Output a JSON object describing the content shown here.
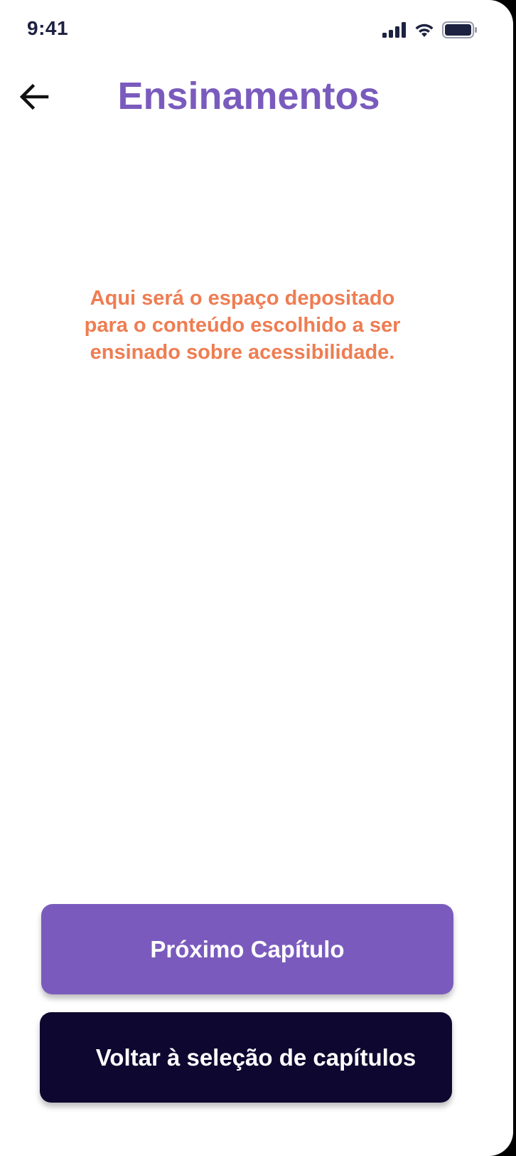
{
  "status_bar": {
    "time": "9:41",
    "icons": [
      "signal-icon",
      "wifi-icon",
      "battery-icon"
    ]
  },
  "header": {
    "back_icon": "arrow-left-icon",
    "title": "Ensinamentos"
  },
  "main": {
    "placeholder_text": "Aqui será o espaço depositado para o conteúdo escolhido a ser ensinado sobre acessibilidade."
  },
  "actions": {
    "next_label": "Próximo Capítulo",
    "back_to_selection_label": "Voltar à seleção de capítulos"
  },
  "colors": {
    "accent_purple": "#7a5bbd",
    "accent_orange": "#ee7d52",
    "dark_navy": "#0e0830",
    "status_text": "#1d2240"
  }
}
